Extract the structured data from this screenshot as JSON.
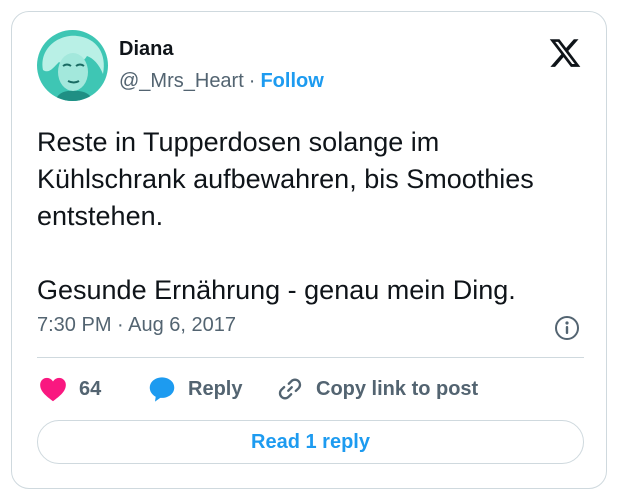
{
  "author": {
    "name": "Diana",
    "handle": "@_Mrs_Heart",
    "separator": "·",
    "follow_label": "Follow",
    "avatar_icon": "profile-photo"
  },
  "brand": {
    "logo_icon": "x-logo"
  },
  "tweet": {
    "paragraphs": [
      "Reste in Tupperdosen solange im Kühlschrank aufbewahren, bis Smoothies entstehen.",
      "Gesunde Ernährung - genau mein Ding."
    ],
    "timestamp": "7:30 PM · Aug 6, 2017",
    "info_icon": "info-icon"
  },
  "actions": {
    "likes_count": "64",
    "like_icon": "heart-icon",
    "reply_label": "Reply",
    "reply_icon": "speech-bubble-icon",
    "copy_label": "Copy link to post",
    "copy_icon": "link-icon"
  },
  "footer": {
    "read_replies_label": "Read 1 reply"
  },
  "colors": {
    "accent": "#1d9bf0",
    "like": "#f91880",
    "text_primary": "#0f1419",
    "text_secondary": "#536471",
    "border": "#cfd9de",
    "avatar_tint": "#3ec6b4"
  }
}
